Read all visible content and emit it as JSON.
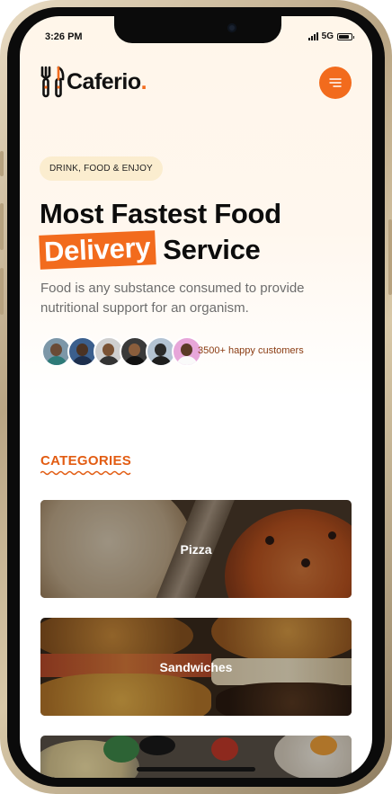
{
  "status_bar": {
    "time": "3:26 PM",
    "network": "5G",
    "battery_level": 0.85
  },
  "header": {
    "brand": "Caferio",
    "brand_dot": ".",
    "logo_icon": "fork-knife-icon",
    "menu_icon": "menu-lines-icon"
  },
  "colors": {
    "accent": "#f26b1d",
    "accent_dark": "#e25c12",
    "tag_bg": "#fbedcf"
  },
  "hero": {
    "tag": "DRINK, FOOD & ENJOY",
    "headline_line1": "Most Fastest Food",
    "headline_highlight": "Delivery",
    "headline_line2_rest": "Service",
    "description": "Food is any substance consumed to provide nutritional support for an organism.",
    "customers_text": "3500+ happy customers"
  },
  "categories": {
    "title": "CATEGORIES",
    "items": [
      {
        "label": "Pizza"
      },
      {
        "label": "Sandwiches"
      },
      {
        "label": ""
      }
    ]
  }
}
